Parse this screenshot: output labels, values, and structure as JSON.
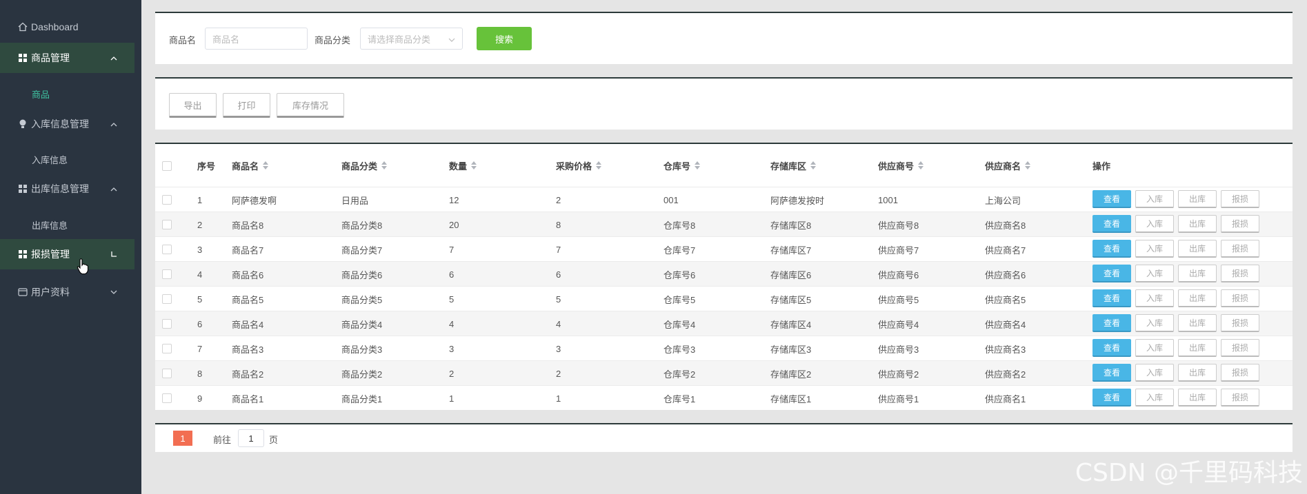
{
  "sidebar": {
    "dashboard": "Dashboard",
    "goods_mgmt": "商品管理",
    "goods": "商品",
    "inbound_mgmt": "入库信息管理",
    "inbound_info": "入库信息",
    "outbound_mgmt": "出库信息管理",
    "outbound_info": "出库信息",
    "damage_mgmt": "报损管理",
    "user_profile": "用户资料"
  },
  "search": {
    "name_label": "商品名",
    "name_placeholder": "商品名",
    "category_label": "商品分类",
    "category_placeholder": "请选择商品分类",
    "search_button": "搜索"
  },
  "toolbar": {
    "export": "导出",
    "print": "打印",
    "stock": "库存情况"
  },
  "table": {
    "headers": {
      "index": "序号",
      "name": "商品名",
      "category": "商品分类",
      "qty": "数量",
      "price": "采购价格",
      "warehouse": "仓库号",
      "zone": "存储库区",
      "supplier_no": "供应商号",
      "supplier_name": "供应商名",
      "ops": "操作"
    },
    "actions": {
      "view": "查看",
      "inbound": "入库",
      "outbound": "出库",
      "damage": "报损"
    },
    "rows": [
      {
        "index": "1",
        "name": "阿萨德发啊",
        "category": "日用品",
        "qty": "12",
        "price": "2",
        "warehouse": "001",
        "zone": "阿萨德发按时",
        "supplier_no": "1001",
        "supplier_name": "上海公司"
      },
      {
        "index": "2",
        "name": "商品名8",
        "category": "商品分类8",
        "qty": "20",
        "price": "8",
        "warehouse": "仓库号8",
        "zone": "存储库区8",
        "supplier_no": "供应商号8",
        "supplier_name": "供应商名8"
      },
      {
        "index": "3",
        "name": "商品名7",
        "category": "商品分类7",
        "qty": "7",
        "price": "7",
        "warehouse": "仓库号7",
        "zone": "存储库区7",
        "supplier_no": "供应商号7",
        "supplier_name": "供应商名7"
      },
      {
        "index": "4",
        "name": "商品名6",
        "category": "商品分类6",
        "qty": "6",
        "price": "6",
        "warehouse": "仓库号6",
        "zone": "存储库区6",
        "supplier_no": "供应商号6",
        "supplier_name": "供应商名6"
      },
      {
        "index": "5",
        "name": "商品名5",
        "category": "商品分类5",
        "qty": "5",
        "price": "5",
        "warehouse": "仓库号5",
        "zone": "存储库区5",
        "supplier_no": "供应商号5",
        "supplier_name": "供应商名5"
      },
      {
        "index": "6",
        "name": "商品名4",
        "category": "商品分类4",
        "qty": "4",
        "price": "4",
        "warehouse": "仓库号4",
        "zone": "存储库区4",
        "supplier_no": "供应商号4",
        "supplier_name": "供应商名4"
      },
      {
        "index": "7",
        "name": "商品名3",
        "category": "商品分类3",
        "qty": "3",
        "price": "3",
        "warehouse": "仓库号3",
        "zone": "存储库区3",
        "supplier_no": "供应商号3",
        "supplier_name": "供应商名3"
      },
      {
        "index": "8",
        "name": "商品名2",
        "category": "商品分类2",
        "qty": "2",
        "price": "2",
        "warehouse": "仓库号2",
        "zone": "存储库区2",
        "supplier_no": "供应商号2",
        "supplier_name": "供应商名2"
      },
      {
        "index": "9",
        "name": "商品名1",
        "category": "商品分类1",
        "qty": "1",
        "price": "1",
        "warehouse": "仓库号1",
        "zone": "存储库区1",
        "supplier_no": "供应商号1",
        "supplier_name": "供应商名1"
      }
    ]
  },
  "pagination": {
    "current": "1",
    "goto_label": "前往",
    "goto_value": "1",
    "page_suffix": "页"
  },
  "watermark": "CSDN @千里码科技",
  "colors": {
    "sidebar_bg": "#2a3440",
    "sidebar_active": "#2f4a3f",
    "accent_green": "#67c23a",
    "view_blue": "#49b6e6",
    "page_orange": "#f26e52",
    "submenu_active": "#3fc1a0"
  },
  "icons": {
    "dashboard": "home-icon",
    "goods_mgmt": "grid-icon",
    "inbound_mgmt": "bulb-icon",
    "outbound_mgmt": "grid-icon",
    "damage_mgmt": "grid-icon",
    "user_profile": "card-icon"
  }
}
